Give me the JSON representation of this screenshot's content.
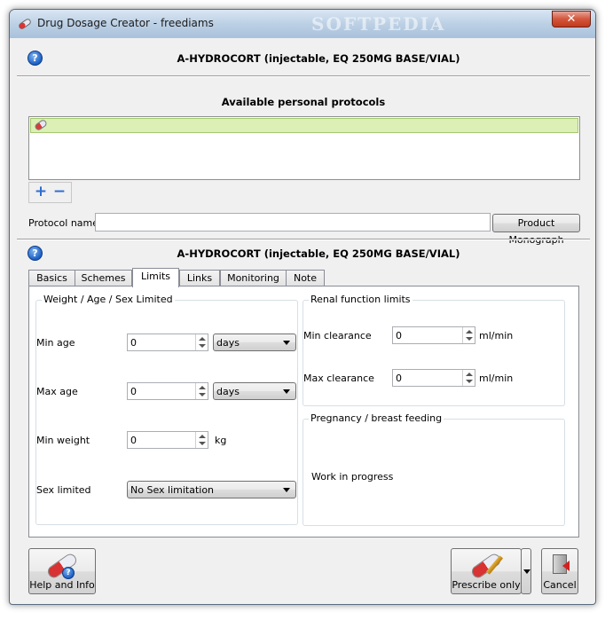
{
  "window": {
    "title": "Drug Dosage Creator - freediams",
    "watermark": "SOFTPEDIA",
    "close_glyph": "✕"
  },
  "drug": {
    "name": "A-HYDROCORT (injectable, EQ 250MG BASE/VIAL)"
  },
  "protocols": {
    "section_title": "Available personal protocols",
    "add_glyph": "+",
    "remove_glyph": "−"
  },
  "protocol_name": {
    "label": "Protocol name",
    "value": ""
  },
  "product_monograph_label": "Product Monograph",
  "tabs": [
    {
      "label": "Basics"
    },
    {
      "label": "Schemes"
    },
    {
      "label": "Limits"
    },
    {
      "label": "Links"
    },
    {
      "label": "Monitoring"
    },
    {
      "label": "Note"
    }
  ],
  "limits": {
    "weight_group": {
      "title": "Weight / Age / Sex Limited",
      "min_age": {
        "label": "Min age",
        "value": "0",
        "unit": "days"
      },
      "max_age": {
        "label": "Max age",
        "value": "0",
        "unit": "days"
      },
      "min_weight": {
        "label": "Min weight",
        "value": "0",
        "unit": "kg"
      },
      "sex": {
        "label": "Sex limited",
        "value": "No Sex limitation"
      }
    },
    "renal_group": {
      "title": "Renal function limits",
      "min_clearance": {
        "label": "Min clearance",
        "value": "0",
        "unit": "ml/min"
      },
      "max_clearance": {
        "label": "Max clearance",
        "value": "0",
        "unit": "ml/min"
      }
    },
    "pregnancy_group": {
      "title": "Pregnancy / breast feeding",
      "status": "Work in progress"
    }
  },
  "footer": {
    "help_label": "Help and Info",
    "prescribe_label": "Prescribe only",
    "cancel_label": "Cancel"
  },
  "colors": {
    "selected_row": "#dcefb4",
    "accent_blue": "#1b5fc4",
    "close_red": "#c23a1c"
  }
}
